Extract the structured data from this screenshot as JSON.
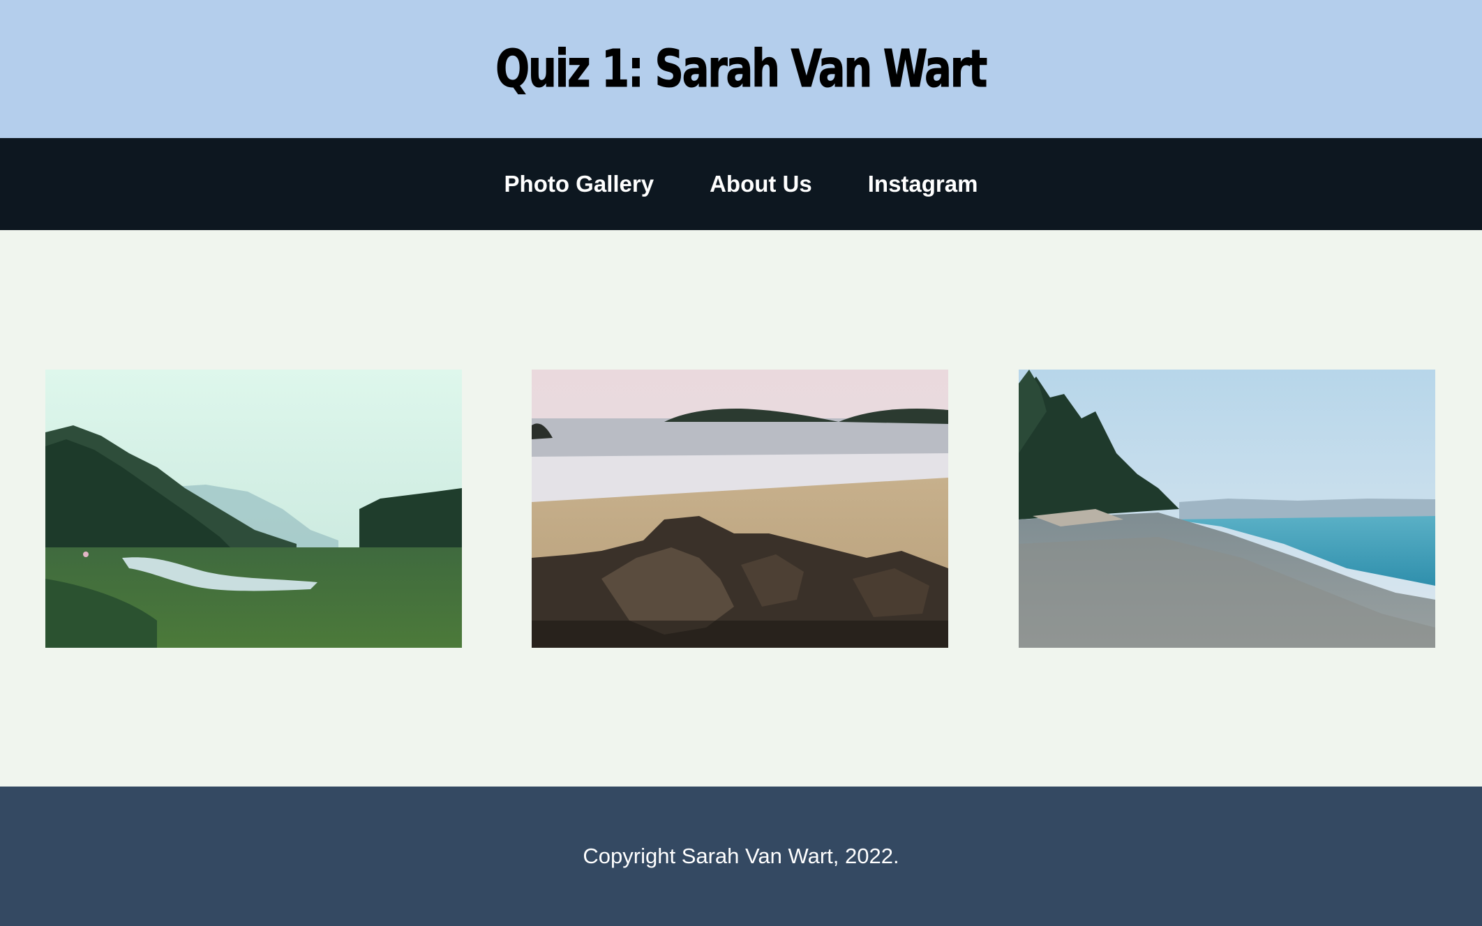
{
  "header": {
    "title": "Quiz 1: Sarah Van Wart"
  },
  "nav": {
    "items": [
      {
        "label": "Photo Gallery"
      },
      {
        "label": "About Us"
      },
      {
        "label": "Instagram"
      }
    ]
  },
  "gallery": {
    "photos": [
      {
        "subject": "forest-river-valley"
      },
      {
        "subject": "sandy-beach-rocks"
      },
      {
        "subject": "pebble-shore-trees"
      }
    ]
  },
  "footer": {
    "copyright": "Copyright Sarah Van Wart, 2022."
  },
  "colors": {
    "header_bg": "#b4ceec",
    "nav_bg": "#0d1720",
    "main_bg": "#f0f5ee",
    "footer_bg": "#344962"
  }
}
